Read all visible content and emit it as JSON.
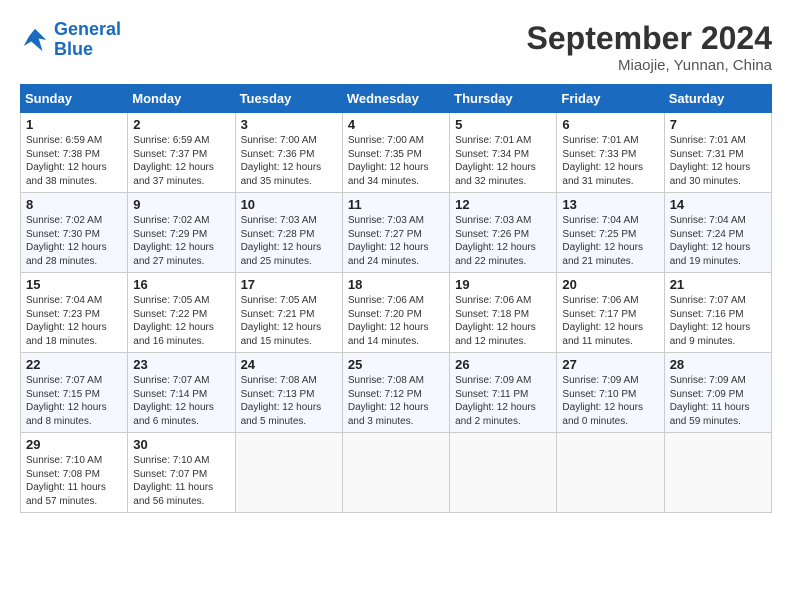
{
  "header": {
    "logo_line1": "General",
    "logo_line2": "Blue",
    "month": "September 2024",
    "location": "Miaojie, Yunnan, China"
  },
  "weekdays": [
    "Sunday",
    "Monday",
    "Tuesday",
    "Wednesday",
    "Thursday",
    "Friday",
    "Saturday"
  ],
  "weeks": [
    [
      {
        "day": "1",
        "info": "Sunrise: 6:59 AM\nSunset: 7:38 PM\nDaylight: 12 hours\nand 38 minutes."
      },
      {
        "day": "2",
        "info": "Sunrise: 6:59 AM\nSunset: 7:37 PM\nDaylight: 12 hours\nand 37 minutes."
      },
      {
        "day": "3",
        "info": "Sunrise: 7:00 AM\nSunset: 7:36 PM\nDaylight: 12 hours\nand 35 minutes."
      },
      {
        "day": "4",
        "info": "Sunrise: 7:00 AM\nSunset: 7:35 PM\nDaylight: 12 hours\nand 34 minutes."
      },
      {
        "day": "5",
        "info": "Sunrise: 7:01 AM\nSunset: 7:34 PM\nDaylight: 12 hours\nand 32 minutes."
      },
      {
        "day": "6",
        "info": "Sunrise: 7:01 AM\nSunset: 7:33 PM\nDaylight: 12 hours\nand 31 minutes."
      },
      {
        "day": "7",
        "info": "Sunrise: 7:01 AM\nSunset: 7:31 PM\nDaylight: 12 hours\nand 30 minutes."
      }
    ],
    [
      {
        "day": "8",
        "info": "Sunrise: 7:02 AM\nSunset: 7:30 PM\nDaylight: 12 hours\nand 28 minutes."
      },
      {
        "day": "9",
        "info": "Sunrise: 7:02 AM\nSunset: 7:29 PM\nDaylight: 12 hours\nand 27 minutes."
      },
      {
        "day": "10",
        "info": "Sunrise: 7:03 AM\nSunset: 7:28 PM\nDaylight: 12 hours\nand 25 minutes."
      },
      {
        "day": "11",
        "info": "Sunrise: 7:03 AM\nSunset: 7:27 PM\nDaylight: 12 hours\nand 24 minutes."
      },
      {
        "day": "12",
        "info": "Sunrise: 7:03 AM\nSunset: 7:26 PM\nDaylight: 12 hours\nand 22 minutes."
      },
      {
        "day": "13",
        "info": "Sunrise: 7:04 AM\nSunset: 7:25 PM\nDaylight: 12 hours\nand 21 minutes."
      },
      {
        "day": "14",
        "info": "Sunrise: 7:04 AM\nSunset: 7:24 PM\nDaylight: 12 hours\nand 19 minutes."
      }
    ],
    [
      {
        "day": "15",
        "info": "Sunrise: 7:04 AM\nSunset: 7:23 PM\nDaylight: 12 hours\nand 18 minutes."
      },
      {
        "day": "16",
        "info": "Sunrise: 7:05 AM\nSunset: 7:22 PM\nDaylight: 12 hours\nand 16 minutes."
      },
      {
        "day": "17",
        "info": "Sunrise: 7:05 AM\nSunset: 7:21 PM\nDaylight: 12 hours\nand 15 minutes."
      },
      {
        "day": "18",
        "info": "Sunrise: 7:06 AM\nSunset: 7:20 PM\nDaylight: 12 hours\nand 14 minutes."
      },
      {
        "day": "19",
        "info": "Sunrise: 7:06 AM\nSunset: 7:18 PM\nDaylight: 12 hours\nand 12 minutes."
      },
      {
        "day": "20",
        "info": "Sunrise: 7:06 AM\nSunset: 7:17 PM\nDaylight: 12 hours\nand 11 minutes."
      },
      {
        "day": "21",
        "info": "Sunrise: 7:07 AM\nSunset: 7:16 PM\nDaylight: 12 hours\nand 9 minutes."
      }
    ],
    [
      {
        "day": "22",
        "info": "Sunrise: 7:07 AM\nSunset: 7:15 PM\nDaylight: 12 hours\nand 8 minutes."
      },
      {
        "day": "23",
        "info": "Sunrise: 7:07 AM\nSunset: 7:14 PM\nDaylight: 12 hours\nand 6 minutes."
      },
      {
        "day": "24",
        "info": "Sunrise: 7:08 AM\nSunset: 7:13 PM\nDaylight: 12 hours\nand 5 minutes."
      },
      {
        "day": "25",
        "info": "Sunrise: 7:08 AM\nSunset: 7:12 PM\nDaylight: 12 hours\nand 3 minutes."
      },
      {
        "day": "26",
        "info": "Sunrise: 7:09 AM\nSunset: 7:11 PM\nDaylight: 12 hours\nand 2 minutes."
      },
      {
        "day": "27",
        "info": "Sunrise: 7:09 AM\nSunset: 7:10 PM\nDaylight: 12 hours\nand 0 minutes."
      },
      {
        "day": "28",
        "info": "Sunrise: 7:09 AM\nSunset: 7:09 PM\nDaylight: 11 hours\nand 59 minutes."
      }
    ],
    [
      {
        "day": "29",
        "info": "Sunrise: 7:10 AM\nSunset: 7:08 PM\nDaylight: 11 hours\nand 57 minutes."
      },
      {
        "day": "30",
        "info": "Sunrise: 7:10 AM\nSunset: 7:07 PM\nDaylight: 11 hours\nand 56 minutes."
      },
      {
        "day": "",
        "info": ""
      },
      {
        "day": "",
        "info": ""
      },
      {
        "day": "",
        "info": ""
      },
      {
        "day": "",
        "info": ""
      },
      {
        "day": "",
        "info": ""
      }
    ]
  ]
}
